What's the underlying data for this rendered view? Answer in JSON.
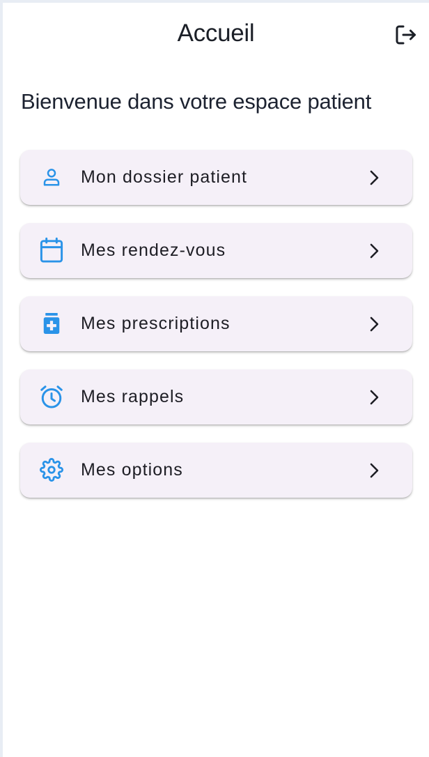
{
  "app_bar": {
    "title": "Accueil",
    "logout_icon": "logout-icon"
  },
  "welcome_text": "Bienvenue dans votre espace patient",
  "accent_color": "#2a93e8",
  "menu": {
    "items": [
      {
        "label": "Mon dossier patient",
        "icon": "person-icon"
      },
      {
        "label": "Mes rendez-vous",
        "icon": "calendar-icon"
      },
      {
        "label": "Mes prescriptions",
        "icon": "medication-icon"
      },
      {
        "label": "Mes rappels",
        "icon": "alarm-icon"
      },
      {
        "label": "Mes options",
        "icon": "gear-icon"
      }
    ]
  }
}
